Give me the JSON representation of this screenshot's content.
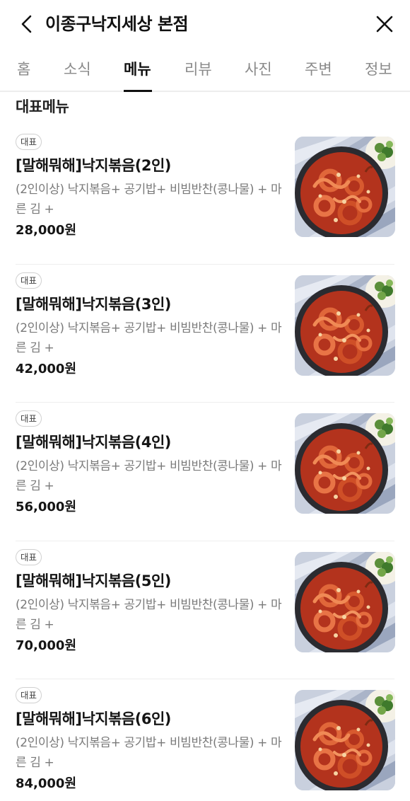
{
  "header": {
    "title": "이종구낙지세상 본점",
    "back_icon": "chevron-left-icon",
    "close_icon": "close-icon"
  },
  "tabs": [
    {
      "label": "홈",
      "active": false
    },
    {
      "label": "소식",
      "active": false
    },
    {
      "label": "메뉴",
      "active": true
    },
    {
      "label": "리뷰",
      "active": false
    },
    {
      "label": "사진",
      "active": false
    },
    {
      "label": "주변",
      "active": false
    },
    {
      "label": "정보",
      "active": false
    }
  ],
  "section": {
    "title": "대표메뉴"
  },
  "menu_items": [
    {
      "badge": "대표",
      "name": "[말해뭐해]낙지볶음(2인)",
      "description": "(2인이상) 낙지볶음+ 공기밥+ 비빔반찬(콩나물) + 마른 김 +",
      "price": "28,000원"
    },
    {
      "badge": "대표",
      "name": "[말해뭐해]낙지볶음(3인)",
      "description": "(2인이상) 낙지볶음+ 공기밥+ 비빔반찬(콩나물) + 마른 김 +",
      "price": "42,000원"
    },
    {
      "badge": "대표",
      "name": "[말해뭐해]낙지볶음(4인)",
      "description": "(2인이상) 낙지볶음+ 공기밥+ 비빔반찬(콩나물) + 마른 김 +",
      "price": "56,000원"
    },
    {
      "badge": "대표",
      "name": "[말해뭐해]낙지볶음(5인)",
      "description": "(2인이상) 낙지볶음+ 공기밥+ 비빔반찬(콩나물) + 마른 김 +",
      "price": "70,000원"
    },
    {
      "badge": "대표",
      "name": "[말해뭐해]낙지볶음(6인)",
      "description": "(2인이상) 낙지볶음+ 공기밥+ 비빔반찬(콩나물) + 마른 김 +",
      "price": "84,000원"
    }
  ],
  "colors": {
    "active_tab": "#111111",
    "inactive_tab": "#8a8a8a",
    "description": "#7a7a7a",
    "divider": "#eeeeee"
  }
}
